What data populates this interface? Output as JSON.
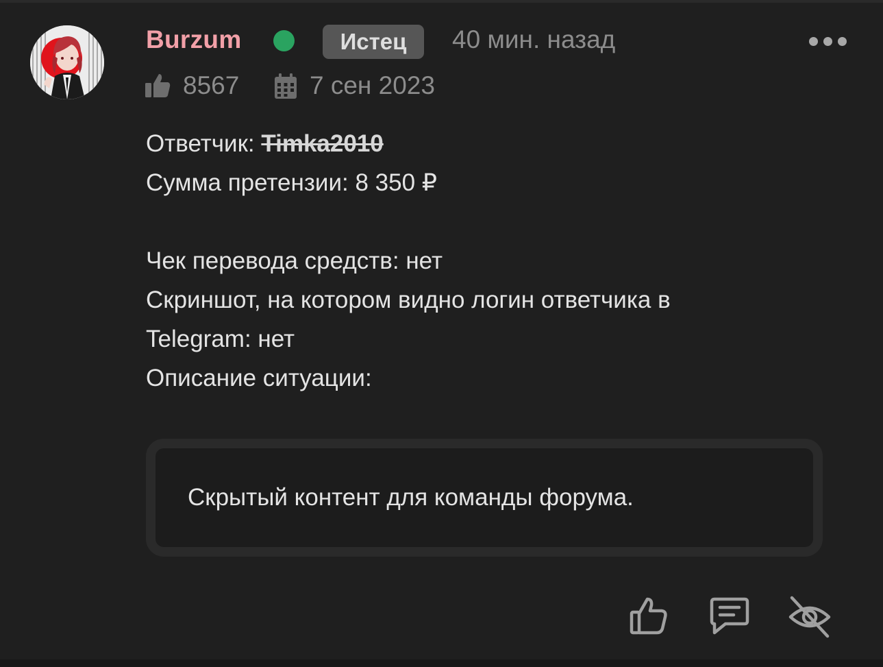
{
  "post": {
    "author": {
      "username": "Burzum",
      "username_color": "#f2a0a8",
      "online_status_color": "#2aa360",
      "role_badge": "Истец",
      "likes": "8567",
      "registered": "7 сен 2023"
    },
    "time_ago": "40 мин. назад",
    "menu_icon": "more-horizontal-icon",
    "body": {
      "respondent_label": "Ответчик:",
      "respondent_name": "Timka2010",
      "claim_line": "Сумма претензии: 8 350 ₽",
      "receipt_line": "Чек перевода средств: нет",
      "screenshot_line_1": "Скриншот, на котором видно логин ответчика в",
      "screenshot_line_2": "Telegram: нет",
      "description_line": "Описание ситуации:"
    },
    "hidden_content": "Скрытый контент для команды форума.",
    "actions": [
      {
        "name": "like",
        "icon": "thumbs-up-icon"
      },
      {
        "name": "reply",
        "icon": "comment-icon"
      },
      {
        "name": "hide",
        "icon": "eye-off-icon"
      }
    ]
  }
}
